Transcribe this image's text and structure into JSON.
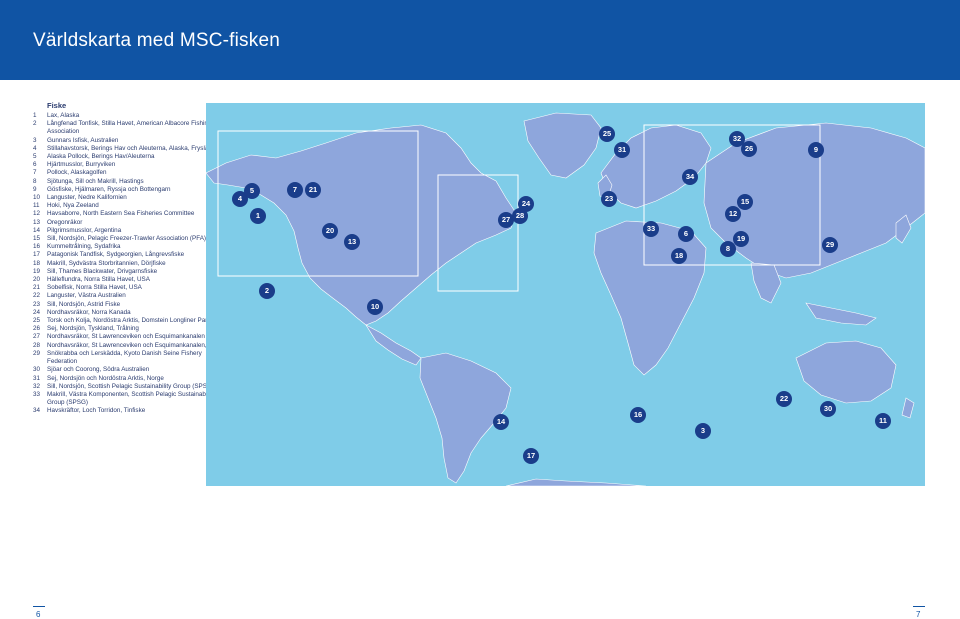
{
  "header": {
    "title": "Världskarta med MSC-fisken"
  },
  "legend": {
    "title": "Fiske",
    "items": [
      {
        "num": "1",
        "text": "Lax, Alaska"
      },
      {
        "num": "2",
        "text": "Långfenad Tonfisk, Stilla Havet, American Albacore Fishing Association"
      },
      {
        "num": "3",
        "text": "Gunnars Isfisk, Australien"
      },
      {
        "num": "4",
        "text": "Stillahavstorsk, Berings Hav och Aleuterna, Alaska, Fryslångrev"
      },
      {
        "num": "5",
        "text": "Alaska Pollock, Berings Hav/Aleuterna"
      },
      {
        "num": "6",
        "text": "Hjärtmusslor, Burryviken"
      },
      {
        "num": "7",
        "text": "Pollock, Alaskagolfen"
      },
      {
        "num": "8",
        "text": "Sjötunga, Sill och Makrill, Hastings"
      },
      {
        "num": "9",
        "text": "Gösfiske, Hjälmaren, Ryssja och Bottengarn"
      },
      {
        "num": "10",
        "text": "Languster, Nedre Kalifornien"
      },
      {
        "num": "11",
        "text": "Hoki, Nya Zeeland"
      },
      {
        "num": "12",
        "text": "Havsaborre, North Eastern Sea Fisheries Committee"
      },
      {
        "num": "13",
        "text": "Oregonräkor"
      },
      {
        "num": "14",
        "text": "Pilgrimsmusslor, Argentina"
      },
      {
        "num": "15",
        "text": "Sill, Nordsjön, Pelagic Freezer-Trawler Association (PFA)"
      },
      {
        "num": "16",
        "text": "Kummeltrålning, Sydafrika"
      },
      {
        "num": "17",
        "text": "Patagonisk Tandfisk, Sydgeorgien, Långrevsfiske"
      },
      {
        "num": "18",
        "text": "Makrill, Sydvästra Storbritannien, Dörjfiske"
      },
      {
        "num": "19",
        "text": "Sill, Thames Blackwater, Drivgarnsfiske"
      },
      {
        "num": "20",
        "text": "Hälleflundra, Norra Stilla Havet, USA"
      },
      {
        "num": "21",
        "text": "Sobelfisk, Norra Stilla Havet, USA"
      },
      {
        "num": "22",
        "text": "Languster, Västra Australien"
      },
      {
        "num": "23",
        "text": "Sill, Nordsjön, Astrid Fiske"
      },
      {
        "num": "24",
        "text": "Nordhavsräkor, Norra Kanada"
      },
      {
        "num": "25",
        "text": "Torsk och Kolja, Nordöstra Arktis, Domstein Longliner Partners"
      },
      {
        "num": "26",
        "text": "Sej, Nordsjön, Tyskland, Trålning"
      },
      {
        "num": "27",
        "text": "Nordhavsräkor, St Lawrenceviken och Esquimankanalen"
      },
      {
        "num": "28",
        "text": "Nordhavsräkor, St Lawrenceviken och Esquimankanalen, trålfiske"
      },
      {
        "num": "29",
        "text": "Snökrabba och Lerskädda, Kyoto Danish Seine Fishery Federation"
      },
      {
        "num": "30",
        "text": "Sjöar och Coorong, Södra Australien"
      },
      {
        "num": "31",
        "text": "Sej, Nordsjön och Nordöstra Arktis, Norge"
      },
      {
        "num": "32",
        "text": "Sill, Nordsjön, Scottish Pelagic Sustainability Group (SPSG)"
      },
      {
        "num": "33",
        "text": "Makrill, Västra Komponenten, Scottish Pelagic Sustainability Group (SPSG)"
      },
      {
        "num": "34",
        "text": "Havskräftor, Loch Torridon, Tinfiske"
      }
    ]
  },
  "map": {
    "ocean_color": "#7fcce8",
    "land_color": "#8ea6dc",
    "marker_color": "#1a3d8a",
    "markers": [
      "1",
      "2",
      "3",
      "4",
      "5",
      "6",
      "7",
      "8",
      "9",
      "10",
      "11",
      "12",
      "13",
      "14",
      "15",
      "16",
      "17",
      "18",
      "19",
      "20",
      "21",
      "22",
      "23",
      "24",
      "25",
      "26",
      "27",
      "28",
      "29",
      "30",
      "31",
      "32",
      "33",
      "34"
    ]
  },
  "footer": {
    "left_page": "6",
    "right_page": "7"
  }
}
